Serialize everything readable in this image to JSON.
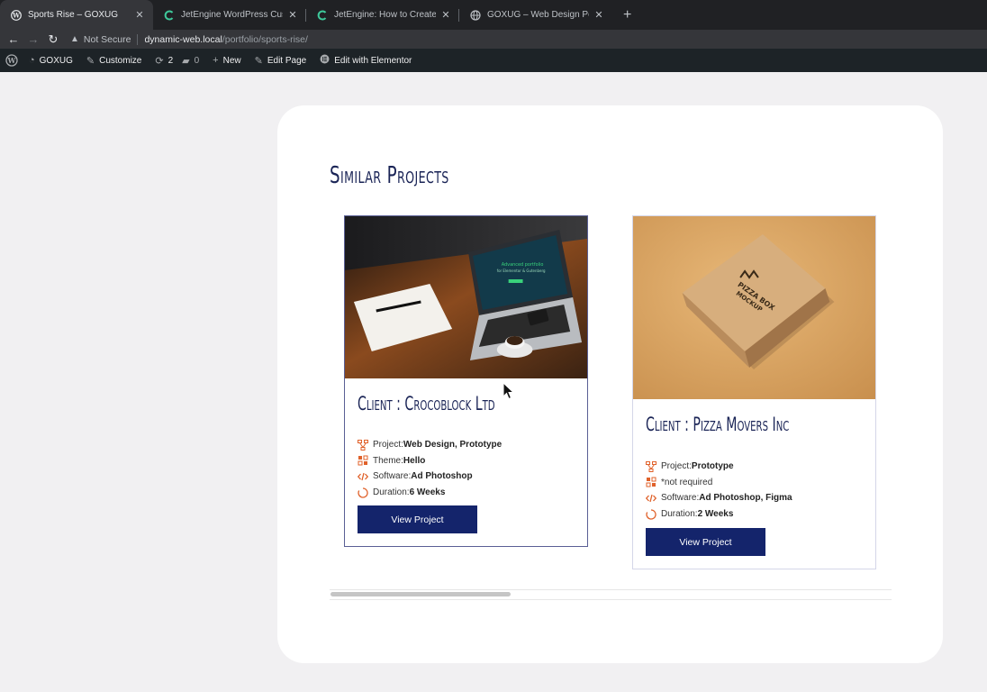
{
  "browser": {
    "tabs": [
      {
        "title": "Sports Rise – GOXUG",
        "icon": "wordpress-icon",
        "active": true
      },
      {
        "title": "JetEngine WordPress Custom",
        "icon": "crocoblock-icon",
        "active": false
      },
      {
        "title": "JetEngine: How to Create Cust",
        "icon": "crocoblock-icon",
        "active": false
      },
      {
        "title": "GOXUG – Web Design Portfolio",
        "icon": "globe-icon",
        "active": false
      }
    ],
    "security_label": "Not Secure",
    "url_host": "dynamic-web.local",
    "url_path": "/portfolio/sports-rise/"
  },
  "adminbar": {
    "site_name": "GOXUG",
    "customize": "Customize",
    "updates_count": "2",
    "comments_count": "0",
    "new": "New",
    "edit_page": "Edit Page",
    "edit_elementor": "Edit with Elementor"
  },
  "section": {
    "title": "Similar Projects"
  },
  "projects": [
    {
      "client": "Client : Crocoblock Ltd",
      "image": "laptop-on-desk-photo",
      "project_label": "Project: ",
      "project_value": "Web Design, Prototype",
      "theme_label": "Theme: ",
      "theme_value": "Hello",
      "software_label": "Software: ",
      "software_value": "Ad Photoshop",
      "duration_label": "Duration: ",
      "duration_value": "6 Weeks",
      "button": "View Project"
    },
    {
      "client": "Client : Pizza Movers Inc",
      "image": "pizza-box-mockup-photo",
      "project_label": "Project: ",
      "project_value": "Prototype",
      "theme_text": "*not required",
      "software_label": "Software: ",
      "software_value": "Ad Photoshop, Figma",
      "duration_label": "Duration: ",
      "duration_value": "2 Weeks",
      "button": "View Project"
    }
  ],
  "laptop_screen_text": {
    "line1": "Advanced portfolio",
    "line2": "for Elementor & Gutenberg"
  },
  "box_text": {
    "line1": "PIZZA BOX",
    "line2": "MOCKUP"
  },
  "colors": {
    "accent": "#14246b",
    "heading": "#1a2456",
    "icon": "#e0612a"
  }
}
